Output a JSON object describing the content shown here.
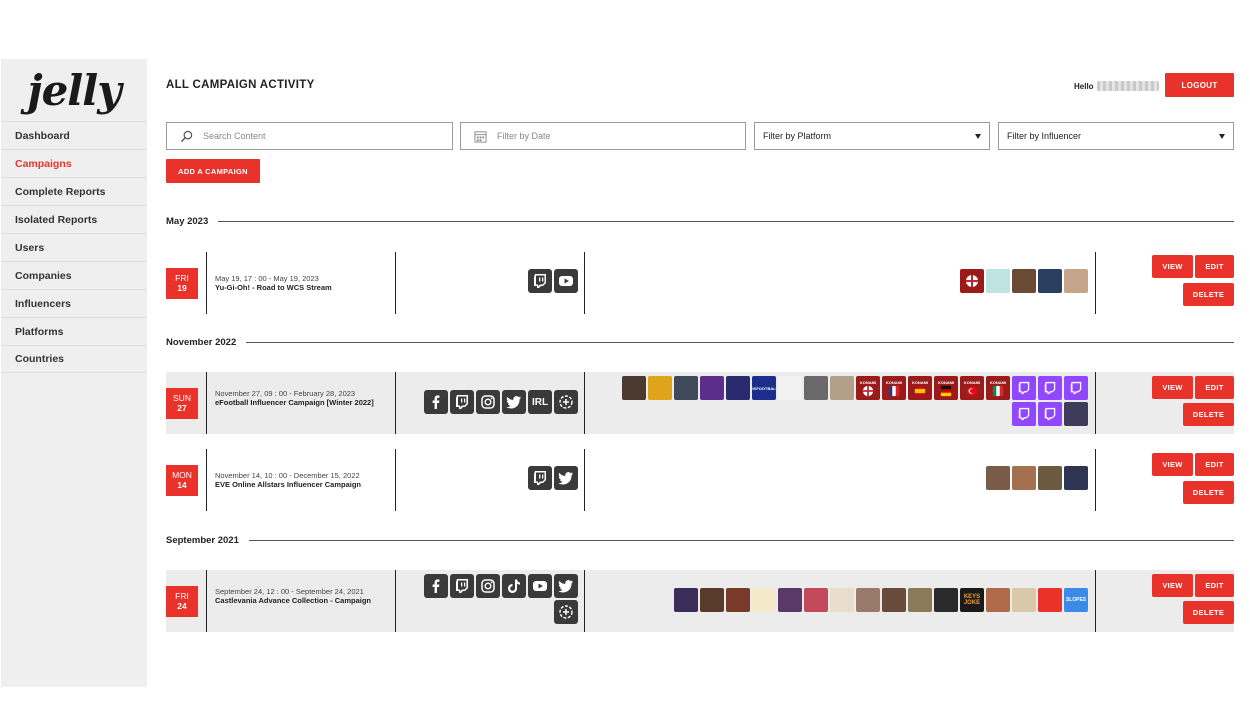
{
  "app": {
    "logo": "jelly"
  },
  "sidebar": {
    "items": [
      {
        "label": "Dashboard",
        "active": false
      },
      {
        "label": "Campaigns",
        "active": true
      },
      {
        "label": "Complete Reports",
        "active": false
      },
      {
        "label": "Isolated Reports",
        "active": false
      },
      {
        "label": "Users",
        "active": false
      },
      {
        "label": "Companies",
        "active": false
      },
      {
        "label": "Influencers",
        "active": false
      },
      {
        "label": "Platforms",
        "active": false
      },
      {
        "label": "Countries",
        "active": false
      }
    ]
  },
  "header": {
    "title": "ALL CAMPAIGN ACTIVITY",
    "hello": "Hello",
    "logout": "LOGOUT"
  },
  "filters": {
    "search_placeholder": "Search Content",
    "date_placeholder": "Filter by Date",
    "platform": "Filter by Platform",
    "influencer": "Filter by Influencer"
  },
  "add_campaign": "ADD A CAMPAIGN",
  "actions": {
    "view": "VIEW",
    "edit": "EDIT",
    "delete": "DELETE"
  },
  "sections": [
    {
      "month": "May 2023",
      "campaigns": [
        {
          "dow": "FRI",
          "day": "19",
          "range": "May 19, 17 : 00 - May 19, 2023",
          "name": "Yu-Gi-Oh! - Road to WCS Stream",
          "platforms": [
            "twitch-icon",
            "youtube-icon"
          ],
          "influencers": 5
        }
      ]
    },
    {
      "month": "November 2022",
      "campaigns": [
        {
          "dow": "SUN",
          "day": "27",
          "range": "November 27, 09 : 00 - February 28, 2023",
          "name": "eFootball Influencer Campaign [Winter 2022]",
          "platforms": [
            "facebook-icon",
            "twitch-icon",
            "instagram-icon",
            "twitter-icon",
            "irl-icon",
            "add-platform-icon"
          ],
          "influencers": 20,
          "badge_labels": [
            "PIXFOOTBALL",
            "KONAMI",
            "KONAMI",
            "KONAMI",
            "KONAMI",
            "KONAMI",
            "KONAMI"
          ]
        },
        {
          "dow": "MON",
          "day": "14",
          "range": "November 14, 10 : 00 - December 15, 2022",
          "name": "EVE Online Allstars Influencer Campaign",
          "platforms": [
            "twitch-icon",
            "twitter-icon"
          ],
          "influencers": 4
        }
      ]
    },
    {
      "month": "September 2021",
      "campaigns": [
        {
          "dow": "FRI",
          "day": "24",
          "range": "September 24, 12 : 00 - September 24, 2021",
          "name": "Castlevania Advance Collection - Campaign",
          "platforms": [
            "facebook-icon",
            "twitch-icon",
            "instagram-icon",
            "tiktok-icon",
            "youtube-icon",
            "twitter-icon",
            "add-platform-icon"
          ],
          "influencers": 16,
          "badge_labels": [
            "KEYS JOKE",
            "SLOPES"
          ]
        }
      ]
    }
  ]
}
